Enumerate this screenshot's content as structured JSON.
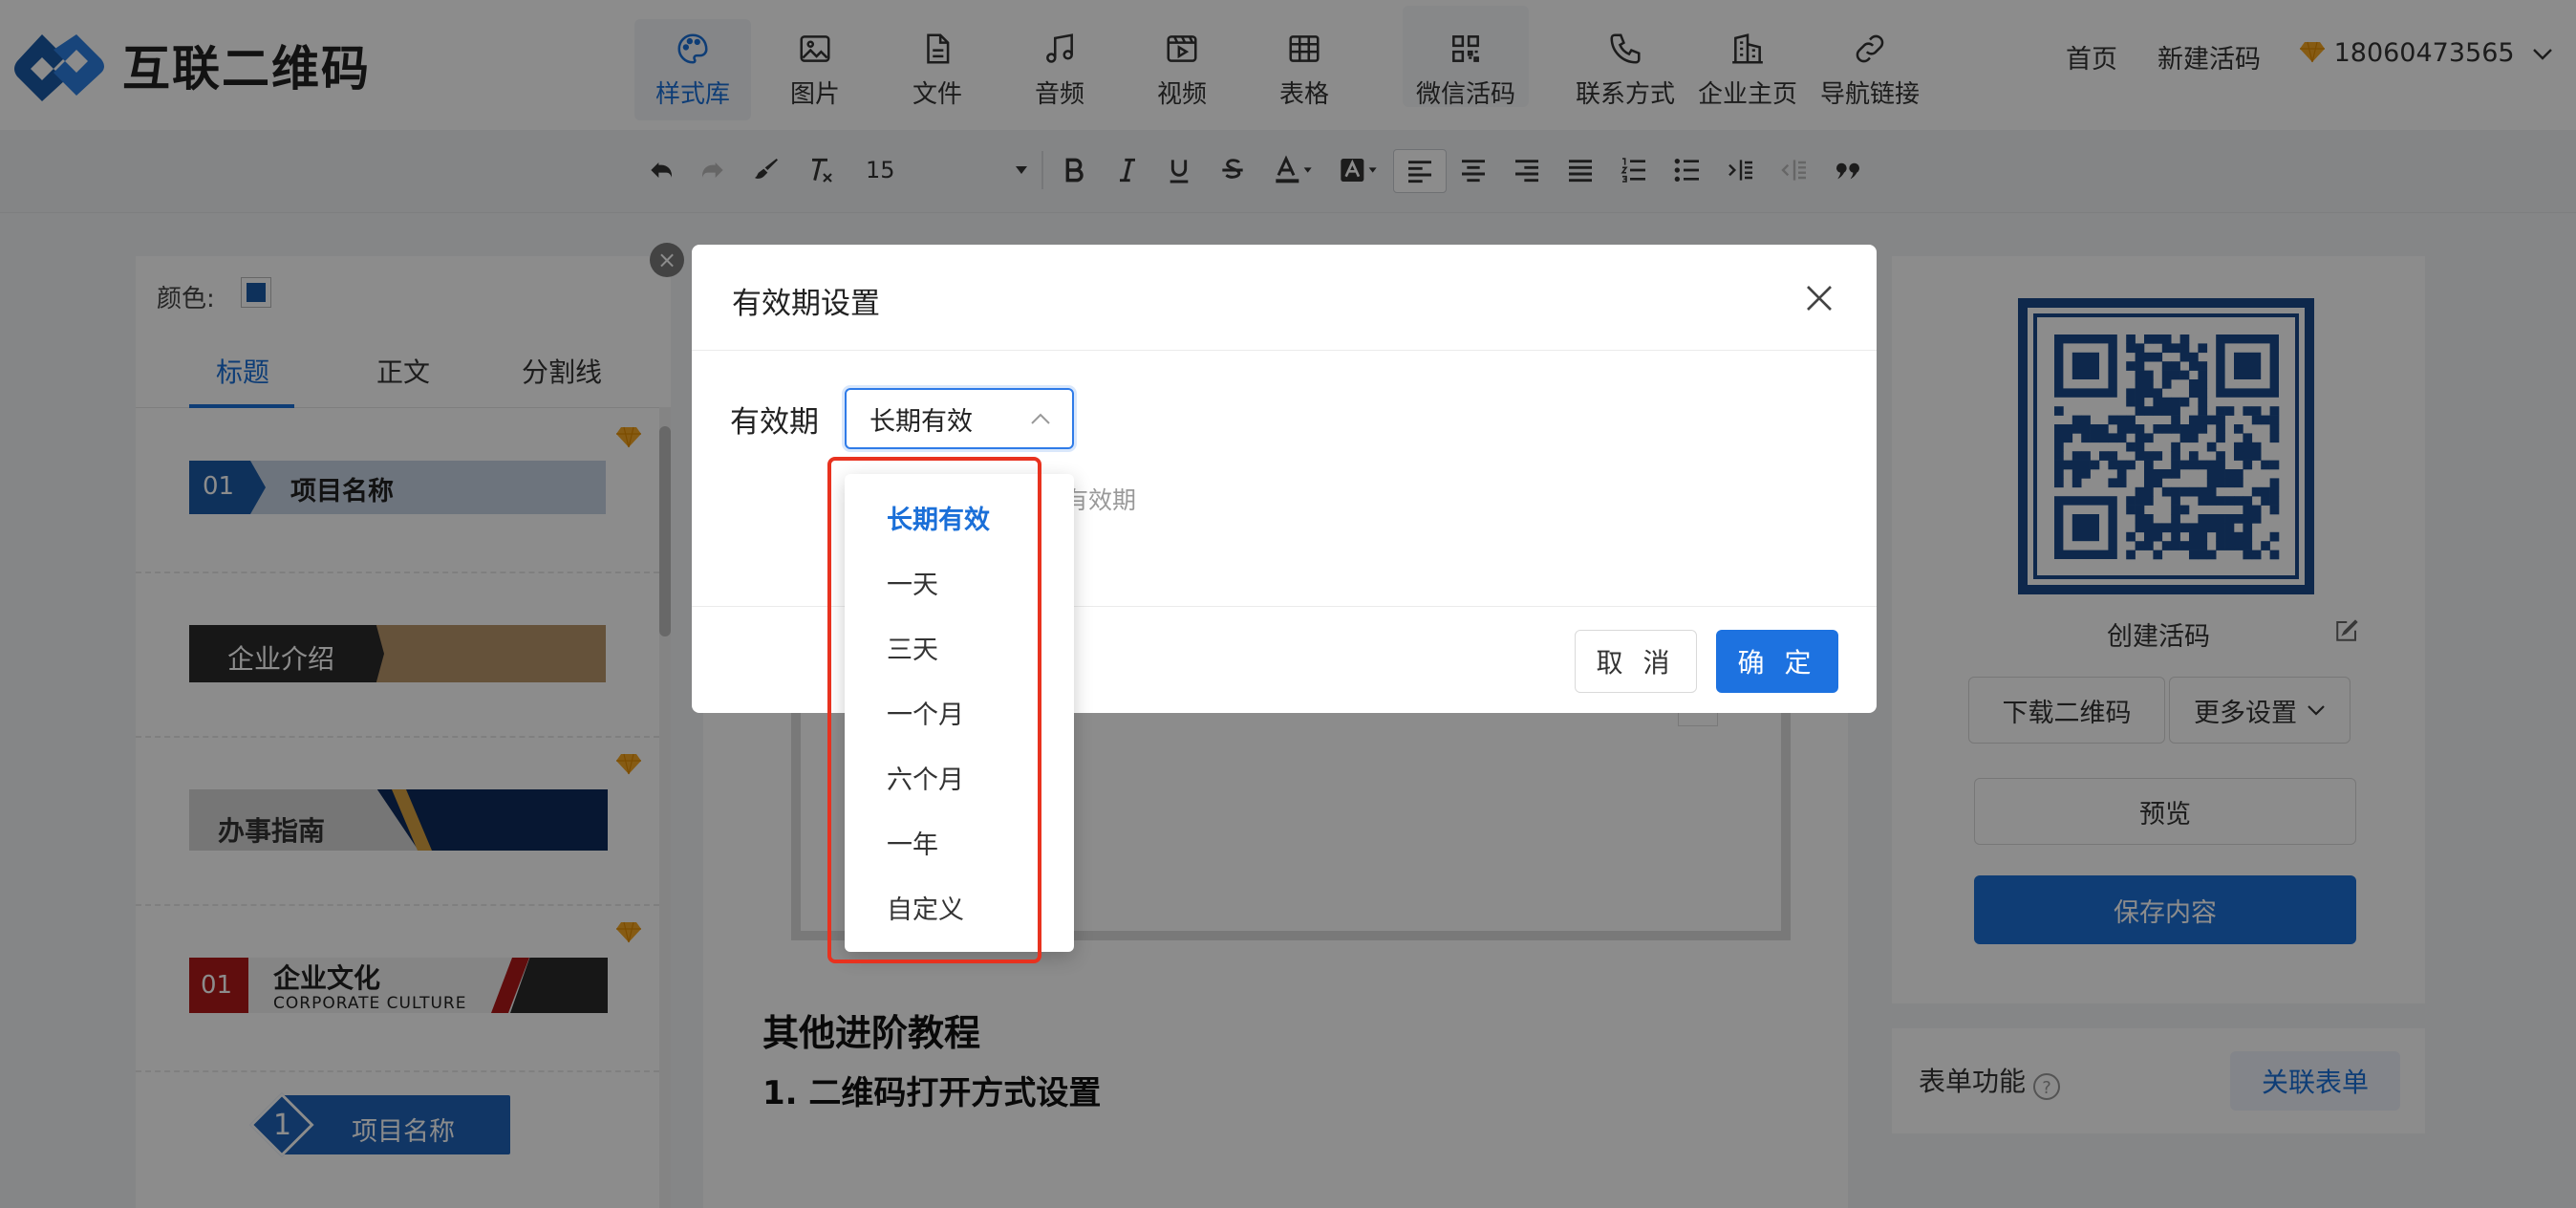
{
  "app": {
    "brand_name": "互联二维码"
  },
  "nav": {
    "items": [
      {
        "label": "样式库",
        "icon": "palette-icon"
      },
      {
        "label": "图片",
        "icon": "image-icon"
      },
      {
        "label": "文件",
        "icon": "file-icon"
      },
      {
        "label": "音频",
        "icon": "music-icon"
      },
      {
        "label": "视频",
        "icon": "video-icon"
      },
      {
        "label": "表格",
        "icon": "table-icon"
      },
      {
        "label": "微信活码",
        "icon": "qr-grid-icon"
      },
      {
        "label": "联系方式",
        "icon": "phone-icon"
      },
      {
        "label": "企业主页",
        "icon": "building-icon"
      },
      {
        "label": "导航链接",
        "icon": "link-icon"
      }
    ],
    "active_index": 0
  },
  "top_right": {
    "home": "首页",
    "new_code": "新建活码",
    "phone": "18060473565"
  },
  "toolbar": {
    "font_size": "15"
  },
  "left_panel": {
    "color_label": "颜色:",
    "tabs": [
      "标题",
      "正文",
      "分割线"
    ],
    "templates": [
      {
        "number": "01",
        "text": "项目名称"
      },
      {
        "text": "企业介绍"
      },
      {
        "text": "办事指南"
      },
      {
        "number": "01",
        "text": "企业文化",
        "sub": "CORPORATE CULTURE"
      },
      {
        "number": "1",
        "text": "项目名称"
      }
    ]
  },
  "center": {
    "title": "其他进阶教程",
    "subtitle": "1. 二维码打开方式设置"
  },
  "right_panel": {
    "qr_caption": "创建活码",
    "download_label": "下载二维码",
    "more_settings_label": "更多设置",
    "preview_label": "预览",
    "save_label": "保存内容",
    "form_label": "表单功能",
    "link_form_label": "关联表单"
  },
  "modal": {
    "title": "有效期设置",
    "field_label": "有效期",
    "selected_value": "长期有效",
    "hint_text": "有效期",
    "cancel_label": "取 消",
    "ok_label": "确 定",
    "options": [
      "长期有效",
      "一天",
      "三天",
      "一个月",
      "六个月",
      "一年",
      "自定义"
    ],
    "selected_index": 0
  },
  "colors": {
    "accent": "#1a6fd8",
    "highlight_border": "#e8321f",
    "primary_button": "#1d72e0"
  }
}
